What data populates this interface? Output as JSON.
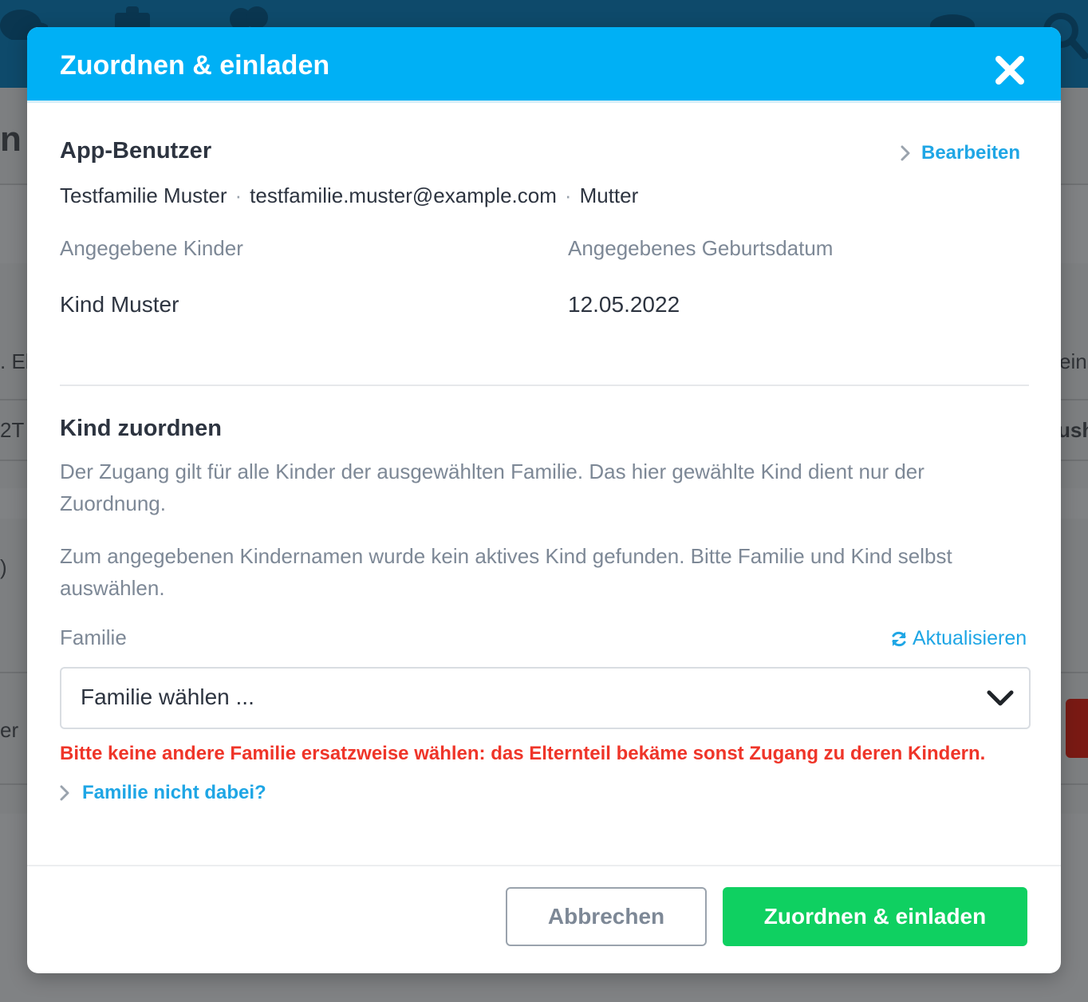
{
  "background": {
    "snippets": [
      "n",
      ". El",
      "ein",
      "2T",
      "ush",
      ")",
      "er"
    ]
  },
  "modal": {
    "title": "Zuordnen & einladen",
    "close_icon": "close-icon",
    "app_user": {
      "heading": "App-Benutzer",
      "edit_label": "Bearbeiten",
      "name": "Testfamilie Muster",
      "email": "testfamilie.muster@example.com",
      "role": "Mutter",
      "separator": "·",
      "children_label": "Angegebene Kinder",
      "birthdate_label": "Angegebenes Geburtsdatum",
      "child_name": "Kind Muster",
      "birthdate": "12.05.2022"
    },
    "assign_child": {
      "heading": "Kind zuordnen",
      "info_text": "Der Zugang gilt für alle Kinder der ausgewählten Familie. Das hier gewählte Kind dient nur der Zuordnung.",
      "notice_text": "Zum angegebenen Kindernamen wurde kein aktives Kind gefunden. Bitte Familie und Kind selbst auswählen.",
      "family_label": "Familie",
      "refresh_label": "Aktualisieren",
      "family_select_value": "Familie wählen ...",
      "warning": "Bitte keine andere Familie ersatzweise wählen: das Elternteil bekäme sonst Zugang zu deren Kindern.",
      "family_missing_link": "Familie nicht dabei?"
    },
    "footer": {
      "cancel_label": "Abbrechen",
      "submit_label": "Zuordnen & einladen"
    }
  },
  "colors": {
    "header": "#00b0f5",
    "link": "#1fa6e5",
    "warning": "#ef3529",
    "primary_button": "#0fd061"
  }
}
